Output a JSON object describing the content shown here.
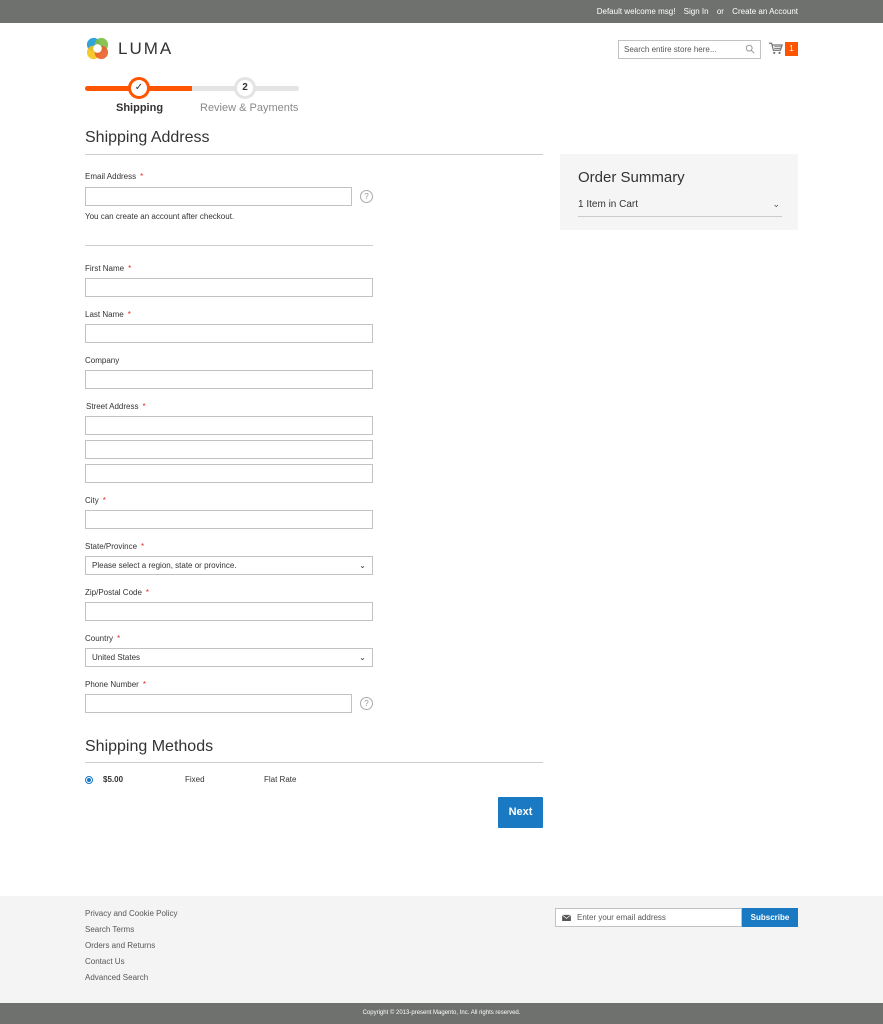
{
  "header": {
    "welcome": "Default welcome msg!",
    "sign_in": "Sign In",
    "or": "or",
    "create_account": "Create an Account",
    "logo_text": "LUMA",
    "search_placeholder": "Search entire store here...",
    "cart_count": "1"
  },
  "progress": {
    "steps": [
      {
        "label": "Shipping",
        "marker": "✓",
        "state": "complete"
      },
      {
        "label": "Review & Payments",
        "marker": "2",
        "state": "pending"
      }
    ],
    "completed_fraction": 0.5
  },
  "shipping_address": {
    "title": "Shipping Address",
    "email_label": "Email Address",
    "email_value": "",
    "email_note": "You can create an account after checkout.",
    "fields": {
      "first_name": {
        "label": "First Name",
        "value": "",
        "required": true
      },
      "last_name": {
        "label": "Last Name",
        "value": "",
        "required": true
      },
      "company": {
        "label": "Company",
        "value": "",
        "required": false
      },
      "street": {
        "label": "Street Address",
        "values": [
          "",
          "",
          ""
        ],
        "required": true
      },
      "city": {
        "label": "City",
        "value": "",
        "required": true
      },
      "state": {
        "label": "State/Province",
        "value": "Please select a region, state or province.",
        "required": true
      },
      "zip": {
        "label": "Zip/Postal Code",
        "value": "",
        "required": true
      },
      "country": {
        "label": "Country",
        "value": "United States",
        "required": true
      },
      "phone": {
        "label": "Phone Number",
        "value": "",
        "required": true
      }
    },
    "required_marker": "*",
    "help_glyph": "?"
  },
  "order_summary": {
    "title": "Order Summary",
    "items_in_cart": "1 Item in Cart"
  },
  "shipping_methods": {
    "title": "Shipping Methods",
    "options": [
      {
        "price": "$5.00",
        "method": "Fixed",
        "carrier": "Flat Rate",
        "selected": true
      }
    ],
    "next_label": "Next"
  },
  "footer": {
    "links": [
      "Privacy and Cookie Policy",
      "Search Terms",
      "Orders and Returns",
      "Contact Us",
      "Advanced Search"
    ],
    "newsletter_placeholder": "Enter your email address",
    "subscribe_label": "Subscribe",
    "copyright": "Copyright © 2013-present Magento, Inc. All rights reserved."
  },
  "colors": {
    "accent_orange": "#ff5501",
    "primary_blue": "#1979c3",
    "bar_gray": "#6e716e"
  }
}
